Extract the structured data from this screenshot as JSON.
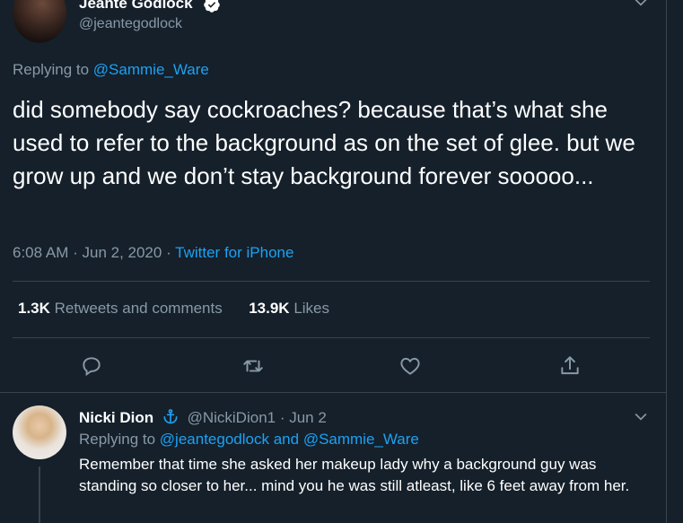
{
  "tweet": {
    "author_name": "Jeante Godlock",
    "author_handle": "@jeantegodlock",
    "replying_prefix": "Replying to",
    "replying_to": "@Sammie_Ware",
    "text": "did somebody say cockroaches? because that’s what she used to refer to the background as on the set of glee. but we grow up and we don’t stay background forever sooooo...",
    "time": "6:08 AM",
    "date": "Jun 2, 2020",
    "source": "Twitter for iPhone",
    "retweets_count": "1.3K",
    "retweets_label": "Retweets and comments",
    "likes_count": "13.9K",
    "likes_label": "Likes"
  },
  "reply": {
    "author_name": "Nicki Dion",
    "author_handle": "@NickiDion1",
    "date": "Jun 2",
    "replying_prefix": "Replying to",
    "replying_to_1": "@jeantegodlock",
    "replying_and": "and",
    "replying_to_2": "@Sammie_Ware",
    "text": "Remember that time she asked her makeup lady why a background guy was standing so closer to her... mind you he was still atleast,  like 6 feet away from her."
  },
  "icons": {
    "verified": "verified-badge-icon",
    "caret": "chevron-down-icon",
    "reply": "comment-icon",
    "retweet": "retweet-icon",
    "like": "heart-icon",
    "share": "share-icon",
    "anchor": "anchor-icon"
  },
  "colors": {
    "background": "#15202b",
    "link": "#1da1f2",
    "muted": "#8899a6",
    "divider": "#38444d"
  }
}
